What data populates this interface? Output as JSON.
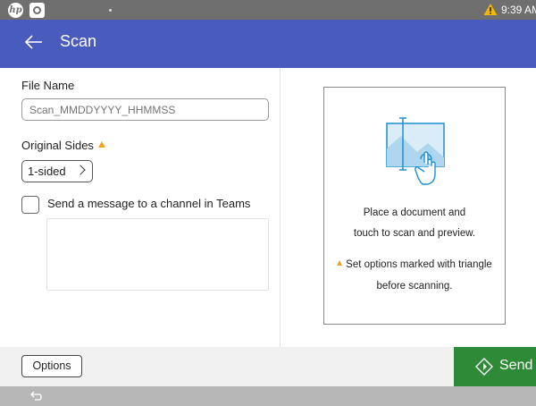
{
  "status_bar": {
    "time": "9:39 AM",
    "icons": [
      "hp-logo-icon",
      "app-icon",
      "warning-icon"
    ]
  },
  "header": {
    "title": "Scan",
    "back_icon": "back-arrow-icon"
  },
  "form": {
    "file_name_label": "File Name",
    "file_name_placeholder": "Scan_MMDDYYYY_HHMMSS",
    "original_sides_label": "Original Sides",
    "original_sides_value": "1-sided",
    "teams_checkbox_label": "Send a message to a channel in Teams",
    "teams_checkbox_checked": false
  },
  "preview": {
    "line1": "Place a document and",
    "line2": "touch to scan and preview.",
    "note_line1": "Set options marked with triangle",
    "note_line2": "before scanning."
  },
  "bottom_bar": {
    "options_label": "Options",
    "send_label": "Send"
  },
  "colors": {
    "header": "#4a5bbe",
    "status_bar": "#6f6f6f",
    "send": "#2f8a37",
    "warning": "#f3a21d"
  }
}
